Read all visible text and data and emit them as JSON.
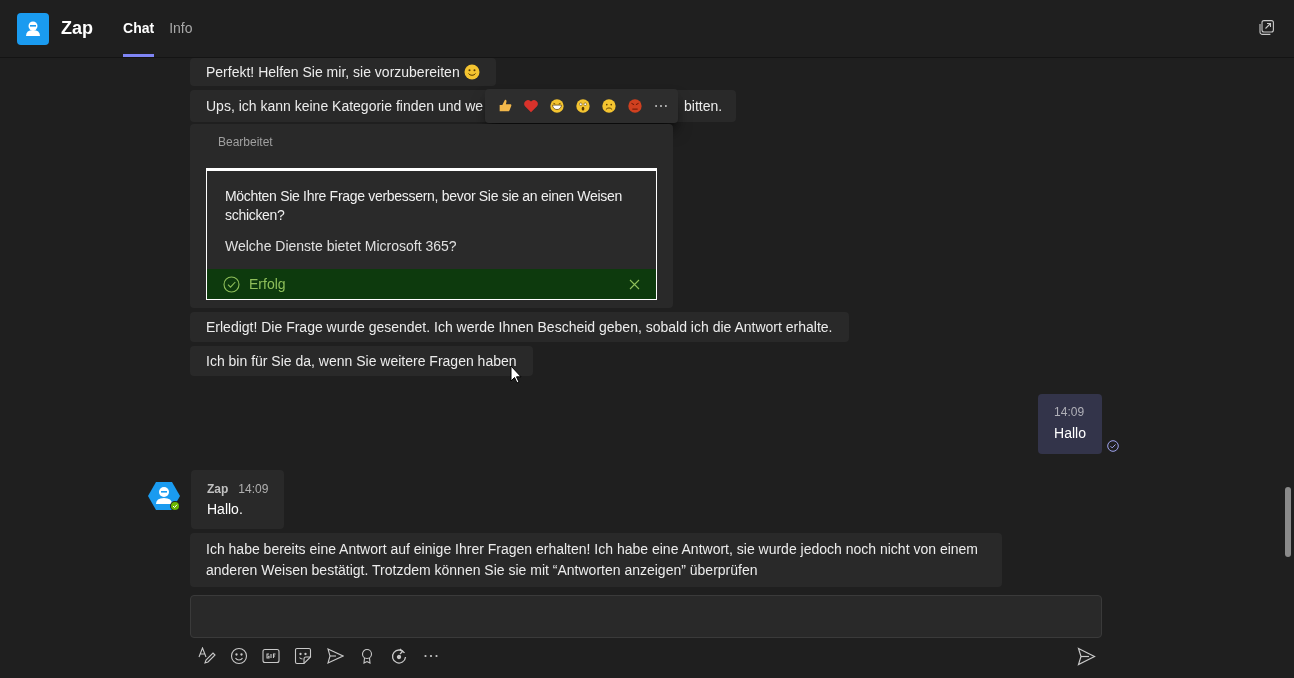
{
  "app": {
    "name": "Zap"
  },
  "tabs": [
    {
      "label": "Chat",
      "selected": true
    },
    {
      "label": "Info",
      "selected": false
    }
  ],
  "messages": [
    {
      "kind": "text",
      "text": "Perfekt! Helfen Sie mir, sie vorzubereiten",
      "smiley": true
    },
    {
      "kind": "covered",
      "text_before": "Ups, ich kann keine Kategorie finden und we",
      "text_after": "bitten."
    },
    {
      "kind": "card",
      "edited_label": "Bearbeitet",
      "question": "Möchten Sie Ihre Frage verbessern, bevor Sie sie an einen Weisen schicken?",
      "example": "Welche Dienste bietet Microsoft 365?",
      "status": "Erfolg"
    },
    {
      "kind": "text",
      "text": "Erledigt! Die Frage wurde gesendet. Ich werde Ihnen Bescheid geben, sobald ich die Antwort erhalte.",
      "smiley": false
    },
    {
      "kind": "text",
      "text": "Ich bin für Sie da, wenn Sie weitere Fragen haben",
      "smiley": false
    },
    {
      "kind": "outgoing",
      "time": "14:09",
      "text": "Hallo"
    },
    {
      "kind": "incoming",
      "sender": "Zap",
      "time": "14:09",
      "text": "Hallo."
    },
    {
      "kind": "text",
      "text": "Ich habe bereits eine Antwort auf einige Ihrer Fragen erhalten! Ich habe eine Antwort, sie wurde jedoch noch nicht von einem anderen Weisen bestätigt. Trotzdem können Sie sie mit “Antworten anzeigen” überprüfen",
      "smiley": false
    }
  ]
}
